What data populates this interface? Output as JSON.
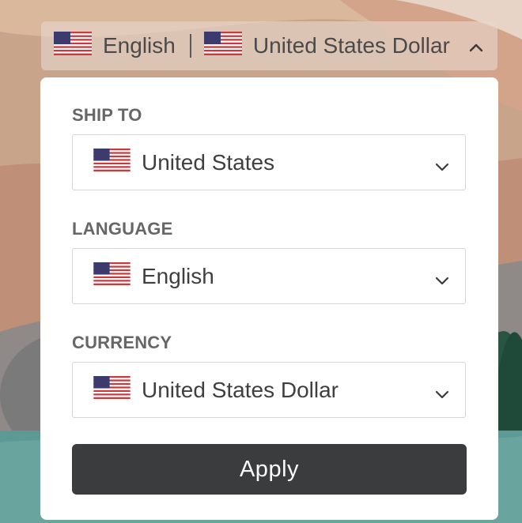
{
  "colors": {
    "panel_bg": "#ffffff",
    "apply_bg": "#3b3c3e",
    "label_color": "#666666",
    "text_color": "#3f3f3f"
  },
  "header": {
    "language": "English",
    "currency": "United States Dollar",
    "language_flag_icon": "us-flag-icon",
    "currency_flag_icon": "us-flag-icon",
    "toggle_icon": "chevron-up-icon"
  },
  "ship_to": {
    "label": "SHIP TO",
    "value": "United States",
    "flag_icon": "us-flag-icon"
  },
  "language": {
    "label": "LANGUAGE",
    "value": "English",
    "flag_icon": "us-flag-icon"
  },
  "currency": {
    "label": "CURRENCY",
    "value": "United States Dollar",
    "flag_icon": "us-flag-icon"
  },
  "apply_label": "Apply"
}
